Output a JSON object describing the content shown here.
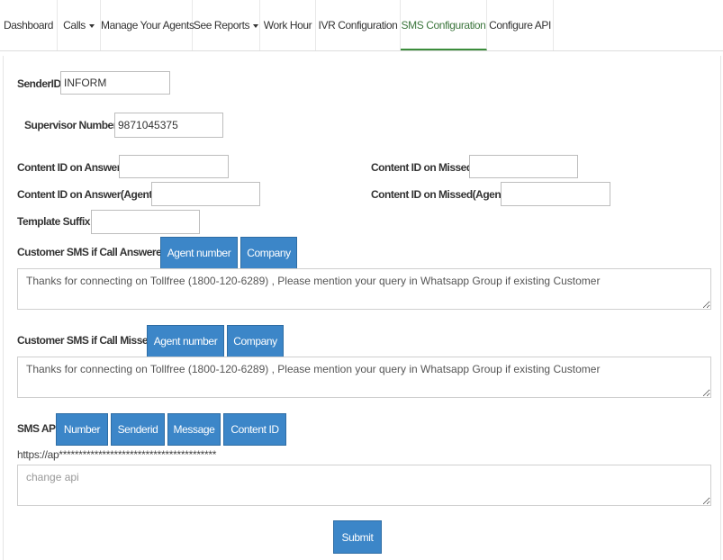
{
  "nav": {
    "tabs": [
      {
        "label": "Dashboard"
      },
      {
        "label": "Calls",
        "dropdown": true
      },
      {
        "label": "Manage Your Agents"
      },
      {
        "label": "See Reports",
        "dropdown": true
      },
      {
        "label": "Work Hour"
      },
      {
        "label": "IVR Configuration"
      },
      {
        "label": "SMS Configuration",
        "active": true
      },
      {
        "label": "Configure API"
      }
    ]
  },
  "form": {
    "sender_id": {
      "label": "SenderID",
      "value": "INFORM"
    },
    "supervisor_number": {
      "label": "Supervisor Number",
      "value": "9871045375"
    },
    "content_id_answer": {
      "label": "Content ID on Answer",
      "value": ""
    },
    "content_id_missed": {
      "label": "Content ID on Missed",
      "value": ""
    },
    "content_id_answer_agent": {
      "label": "Content ID on Answer(Agent)",
      "value": ""
    },
    "content_id_missed_agent": {
      "label": "Content ID on Missed(Agent)",
      "value": ""
    },
    "template_suffix": {
      "label": "Template Suffix",
      "value": ""
    },
    "customer_sms_answered": {
      "label": "Customer SMS if Call Answered",
      "buttons": [
        "Agent number",
        "Company"
      ],
      "value": "Thanks for connecting on Tollfree (1800-120-6289) , Please mention your query in Whatsapp Group if existing Customer"
    },
    "customer_sms_missed": {
      "label": "Customer SMS if Call Missed",
      "buttons": [
        "Agent number",
        "Company"
      ],
      "value": "Thanks for connecting on Tollfree (1800-120-6289) , Please mention your query in Whatsapp Group if existing Customer"
    },
    "sms_api": {
      "label": "SMS API",
      "buttons": [
        "Number",
        "Senderid",
        "Message",
        "Content ID"
      ],
      "masked_url": "https://ap****************************************",
      "placeholder": "change api"
    },
    "submit_label": "Submit"
  },
  "colors": {
    "button_primary": "#3c86c8",
    "active_tab_underline": "#3c8d3c"
  }
}
